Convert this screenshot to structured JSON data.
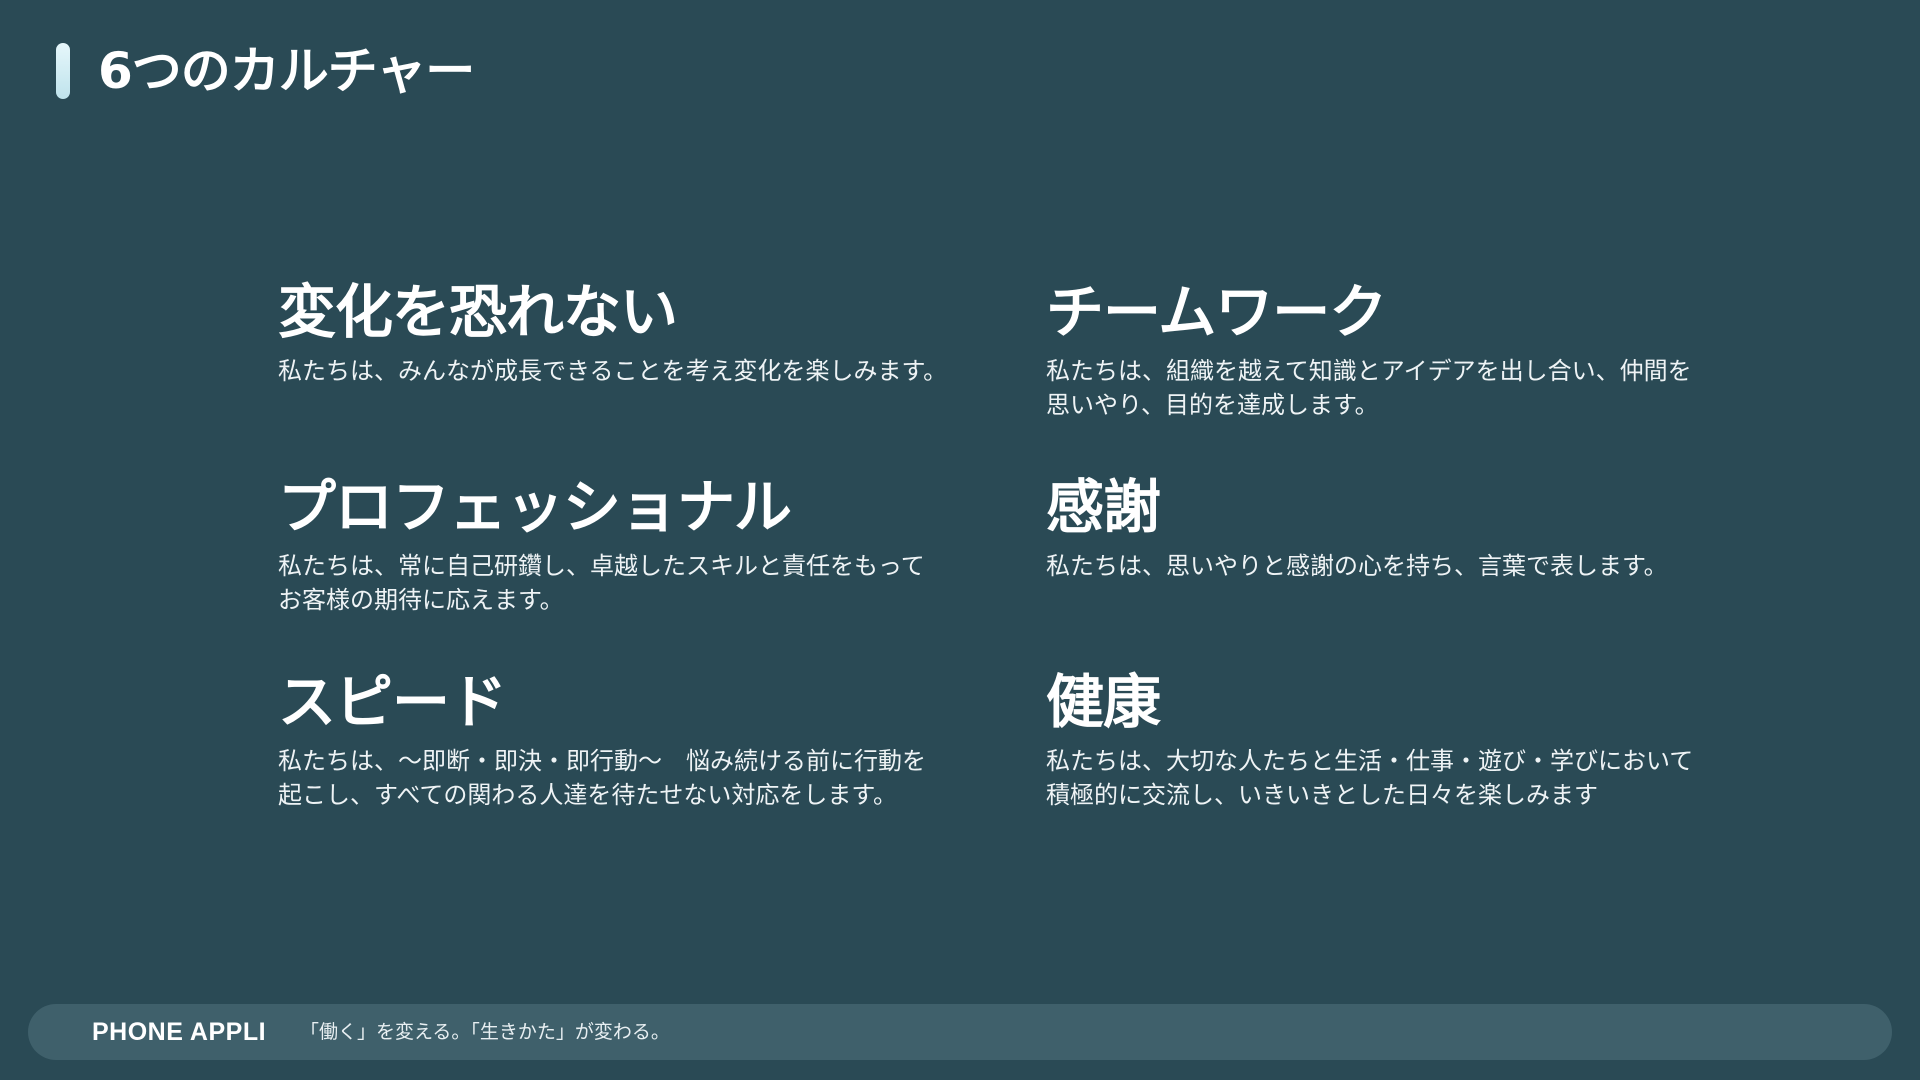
{
  "header": {
    "title": "6つのカルチャー"
  },
  "cultures": [
    {
      "title": "変化を恐れない",
      "text": "私たちは、みんなが成長できることを考え変化を楽しみます。"
    },
    {
      "title": "チームワーク",
      "text": "私たちは、組織を越えて知識とアイデアを出し合い、仲間を\n思いやり、目的を達成します。"
    },
    {
      "title": "プロフェッショナル",
      "text": "私たちは、常に自己研鑽し、卓越したスキルと責任をもって\nお客様の期待に応えます。"
    },
    {
      "title": "感謝",
      "text": "私たちは、思いやりと感謝の心を持ち、言葉で表します。"
    },
    {
      "title": "スピード",
      "text": "私たちは、～即断・即決・即行動～　悩み続ける前に行動を\n起こし、すべての関わる人達を待たせない対応をします。"
    },
    {
      "title": "健康",
      "text": "私たちは、大切な人たちと生活・仕事・遊び・学びにおいて\n積極的に交流し、いきいきとした日々を楽しみます"
    }
  ],
  "footer": {
    "brand": "PHONE APPLI",
    "slogan": "「働く」を変える。「生きかた」が変わる。"
  },
  "colors": {
    "background": "#2a4a55",
    "footer_bar": "#3f606b",
    "title_accent": "#cdebf2"
  }
}
